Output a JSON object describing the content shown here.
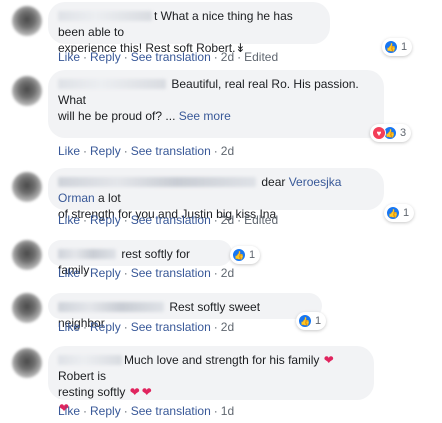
{
  "action_labels": {
    "like": "Like",
    "reply": "Reply",
    "see_translation": "See translation",
    "separator": "·",
    "edited": "Edited"
  },
  "comments": [
    {
      "text_a": "t What a nice thing he has been able to",
      "text_b": "experience this! Rest soft Robert.↡",
      "time": "2d",
      "edited": true,
      "reaction_count": "1"
    },
    {
      "text_a": "Beautiful, real real Ro. His passion. What",
      "text_b": "will he be proud of? ...",
      "see_more": "See more",
      "time": "2d",
      "reaction_count": "3"
    },
    {
      "text_a": "dear",
      "mention": "Veroesjka Orman",
      "text_a2": "a lot",
      "text_b": "of strength for you and Justin big kiss Ina",
      "time": "2d",
      "edited": true,
      "reaction_count": "1"
    },
    {
      "text_a": "rest softly for family",
      "time": "2d",
      "reaction_count": "1"
    },
    {
      "text_a": "Rest softly sweet neighbor",
      "time": "2d",
      "reaction_count": "1"
    },
    {
      "text_a": "Much love and strength for his family",
      "text_a2": "Robert is",
      "text_b": "resting softly",
      "time": "1d"
    }
  ],
  "colors": {
    "bubble": "#f2f3f5",
    "link": "#385898",
    "meta": "#606770",
    "like": "#1877f2",
    "love": "#f33e58",
    "heart": "#e0245e"
  }
}
